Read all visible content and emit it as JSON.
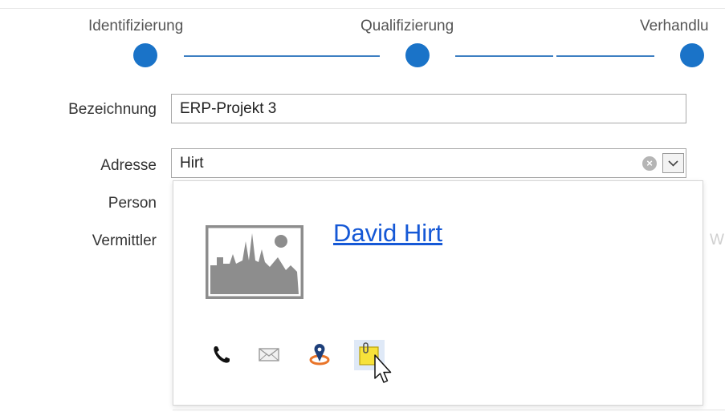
{
  "stepper": {
    "steps": [
      {
        "label": "Identifizierung"
      },
      {
        "label": "Qualifizierung"
      },
      {
        "label": "Verhandlu"
      }
    ]
  },
  "form": {
    "bezeichnung_label": "Bezeichnung",
    "bezeichnung_value": "ERP-Projekt 3",
    "adresse_label": "Adresse",
    "adresse_value": "Hirt",
    "person_label": "Person",
    "vermittler_label": "Vermittler"
  },
  "popup": {
    "contact_name": "David Hirt",
    "actions": [
      "phone-icon",
      "mail-icon",
      "map-pin-icon",
      "note-icon"
    ]
  },
  "right_edge_fragment": "W",
  "colors": {
    "step_dot": "#1a73c8",
    "step_line": "#3d7fc2",
    "link": "#1558d6",
    "note_yellow": "#f7e23a",
    "pin_orange": "#e9752a"
  }
}
